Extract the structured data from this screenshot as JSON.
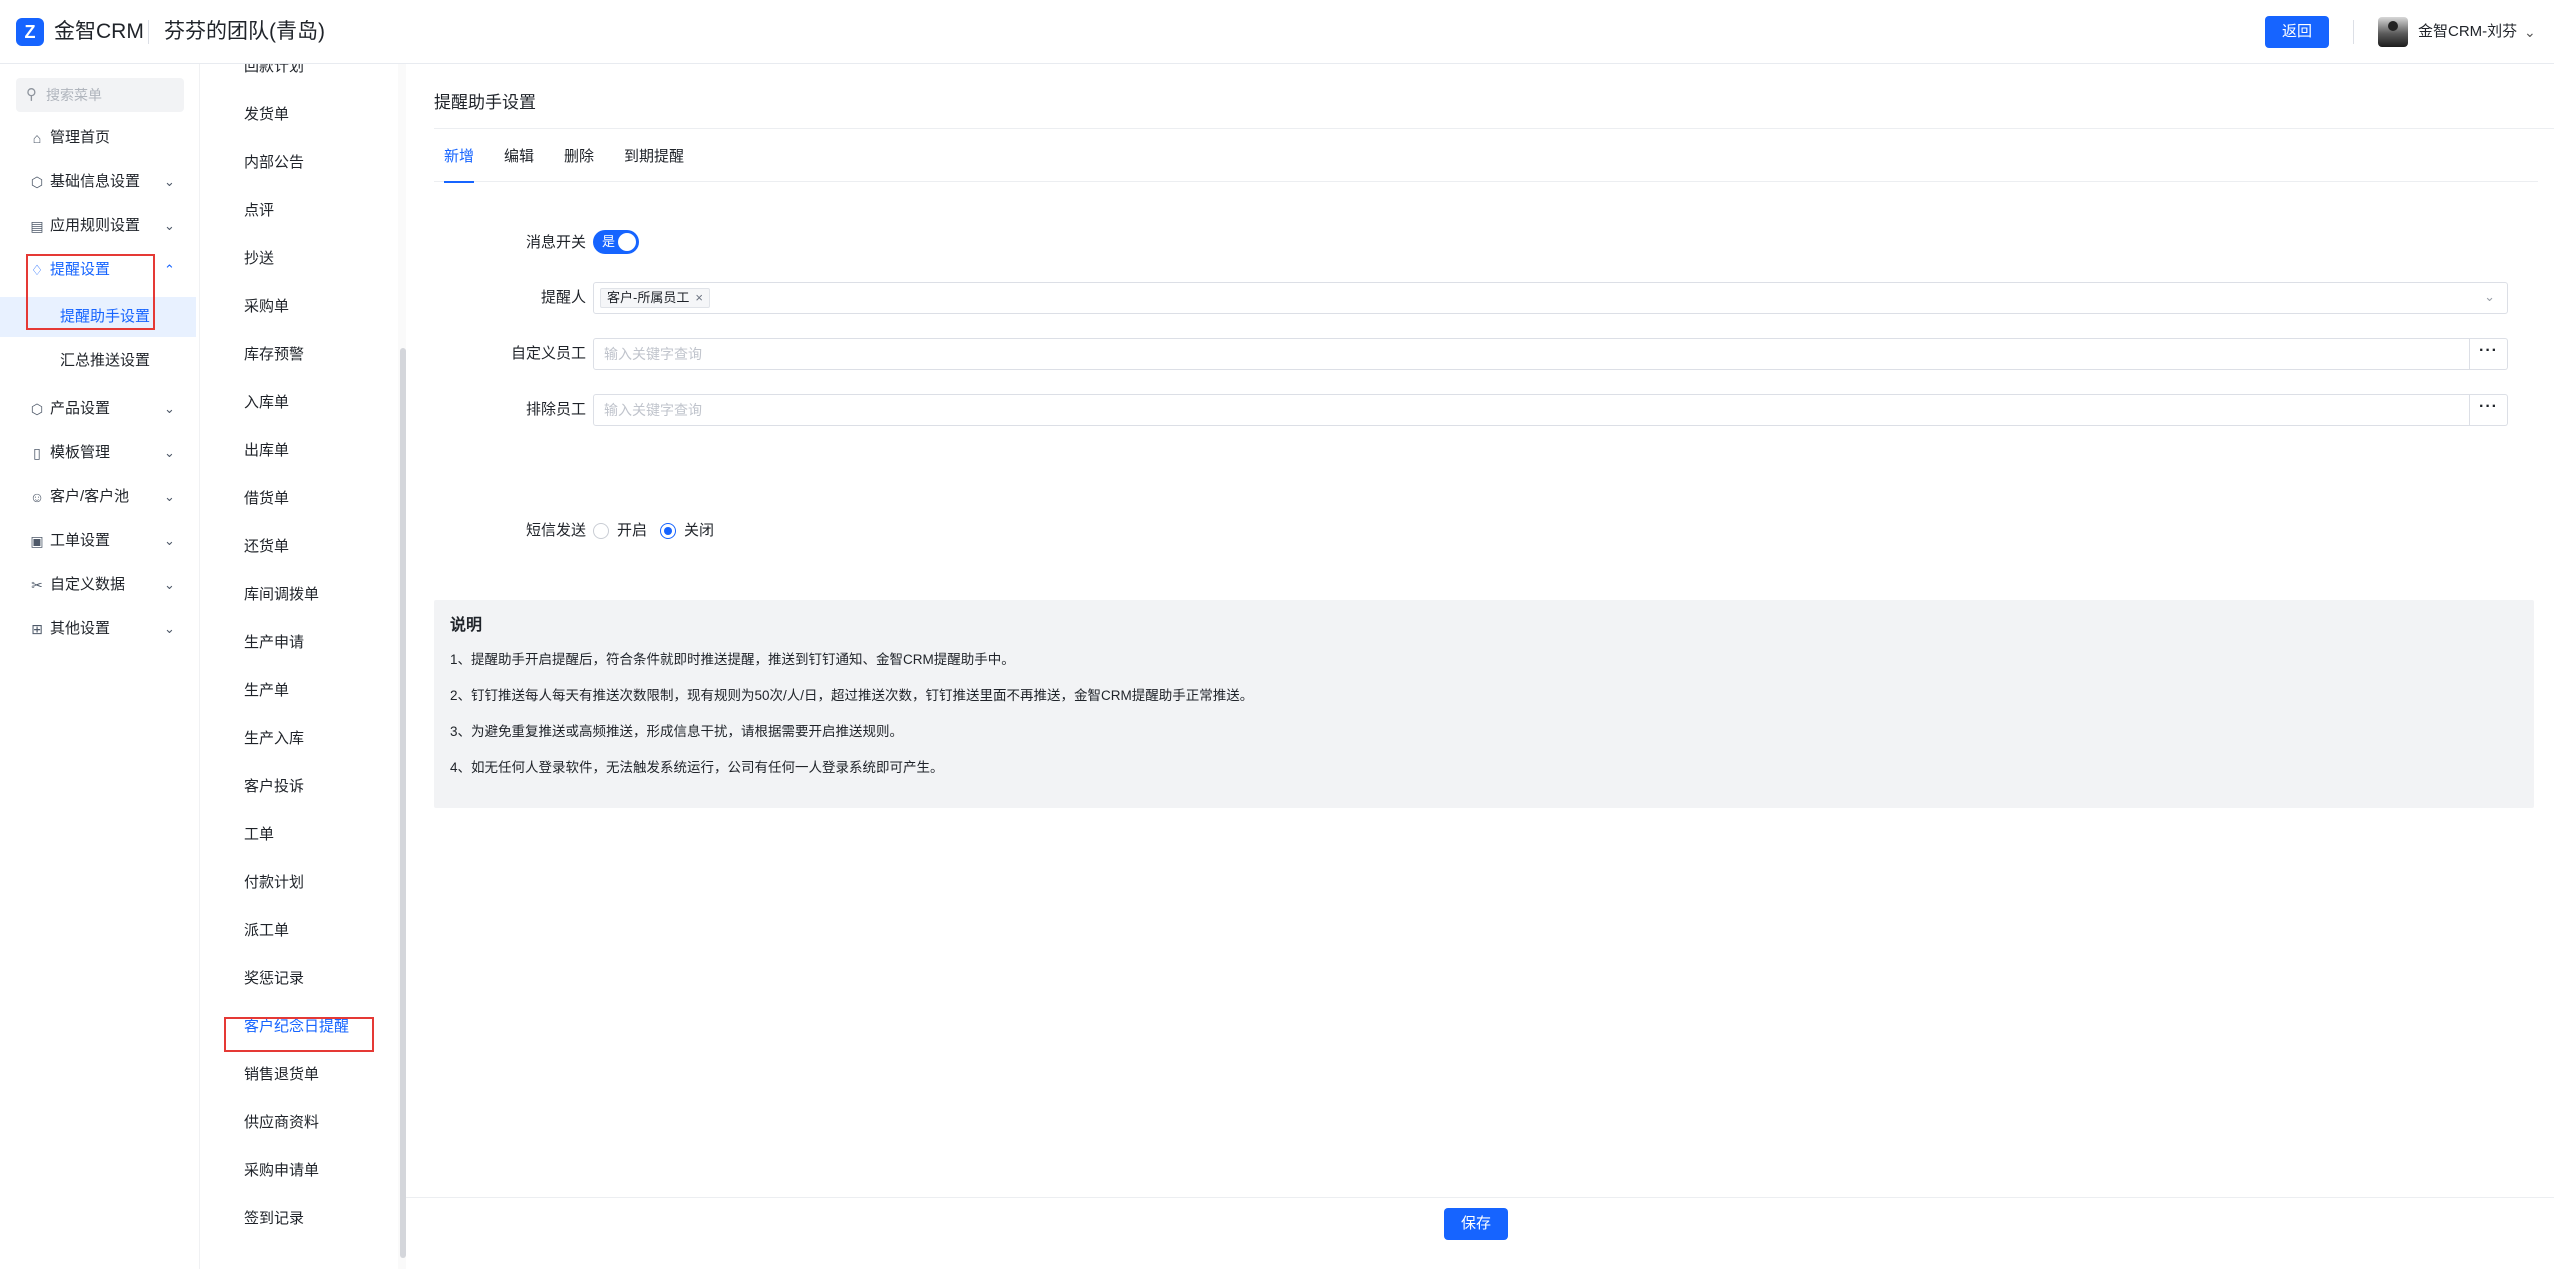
{
  "header": {
    "logo_glyph": "Z",
    "app_name": "金智CRM",
    "team_name": "芬芬的团队(青岛)",
    "back_label": "返回",
    "user_name": "金智CRM-刘芬"
  },
  "sidebar": {
    "search_placeholder": "搜索菜单",
    "items": [
      {
        "label": "管理首页",
        "icon": "home-icon"
      },
      {
        "label": "基础信息设置",
        "icon": "cube-icon"
      },
      {
        "label": "应用规则设置",
        "icon": "document-icon"
      },
      {
        "label": "提醒设置",
        "icon": "bell-icon",
        "active": true
      },
      {
        "label": "提醒助手设置"
      },
      {
        "label": "汇总推送设置"
      },
      {
        "label": "产品设置",
        "icon": "box-icon"
      },
      {
        "label": "模板管理",
        "icon": "template-icon"
      },
      {
        "label": "客户/客户池",
        "icon": "customer-icon"
      },
      {
        "label": "工单设置",
        "icon": "ticket-icon"
      },
      {
        "label": "自定义数据",
        "icon": "custom-data-icon"
      },
      {
        "label": "其他设置",
        "icon": "grid-icon"
      }
    ]
  },
  "midlist": {
    "items": [
      "回款计划",
      "发货单",
      "内部公告",
      "点评",
      "抄送",
      "采购单",
      "库存预警",
      "入库单",
      "出库单",
      "借货单",
      "还货单",
      "库间调拨单",
      "生产申请",
      "生产单",
      "生产入库",
      "客户投诉",
      "工单",
      "付款计划",
      "派工单",
      "奖惩记录",
      "客户纪念日提醒",
      "销售退货单",
      "供应商资料",
      "采购申请单",
      "签到记录"
    ],
    "active_index": 20
  },
  "main": {
    "title": "提醒助手设置",
    "tabs": [
      "新增",
      "编辑",
      "删除",
      "到期提醒"
    ],
    "active_tab": 0,
    "form": {
      "switch_label": "消息开关",
      "switch_value": "是",
      "reminder_label": "提醒人",
      "reminder_tag": "客户-所属员工",
      "custom_label": "自定义员工",
      "custom_placeholder": "输入关键字查询",
      "exclude_label": "排除员工",
      "exclude_placeholder": "输入关键字查询",
      "more_label": "···",
      "sms_label": "短信发送",
      "sms_options": [
        "开启",
        "关闭"
      ],
      "sms_selected": "关闭"
    },
    "note": {
      "title": "说明",
      "lines": [
        "1、提醒助手开启提醒后，符合条件就即时推送提醒，推送到钉钉通知、金智CRM提醒助手中。",
        "2、钉钉推送每人每天有推送次数限制，现有规则为50次/人/日，超过推送次数，钉钉推送里面不再推送，金智CRM提醒助手正常推送。",
        "3、为避免重复推送或高频推送，形成信息干扰，请根据需要开启推送规则。",
        "4、如无任何人登录软件，无法触发系统运行，公司有任何一人登录系统即可产生。"
      ]
    },
    "save_label": "保存"
  },
  "colors": {
    "accent": "#1664ff",
    "highlight_box": "#e53935",
    "note_bg": "#f2f3f5"
  }
}
